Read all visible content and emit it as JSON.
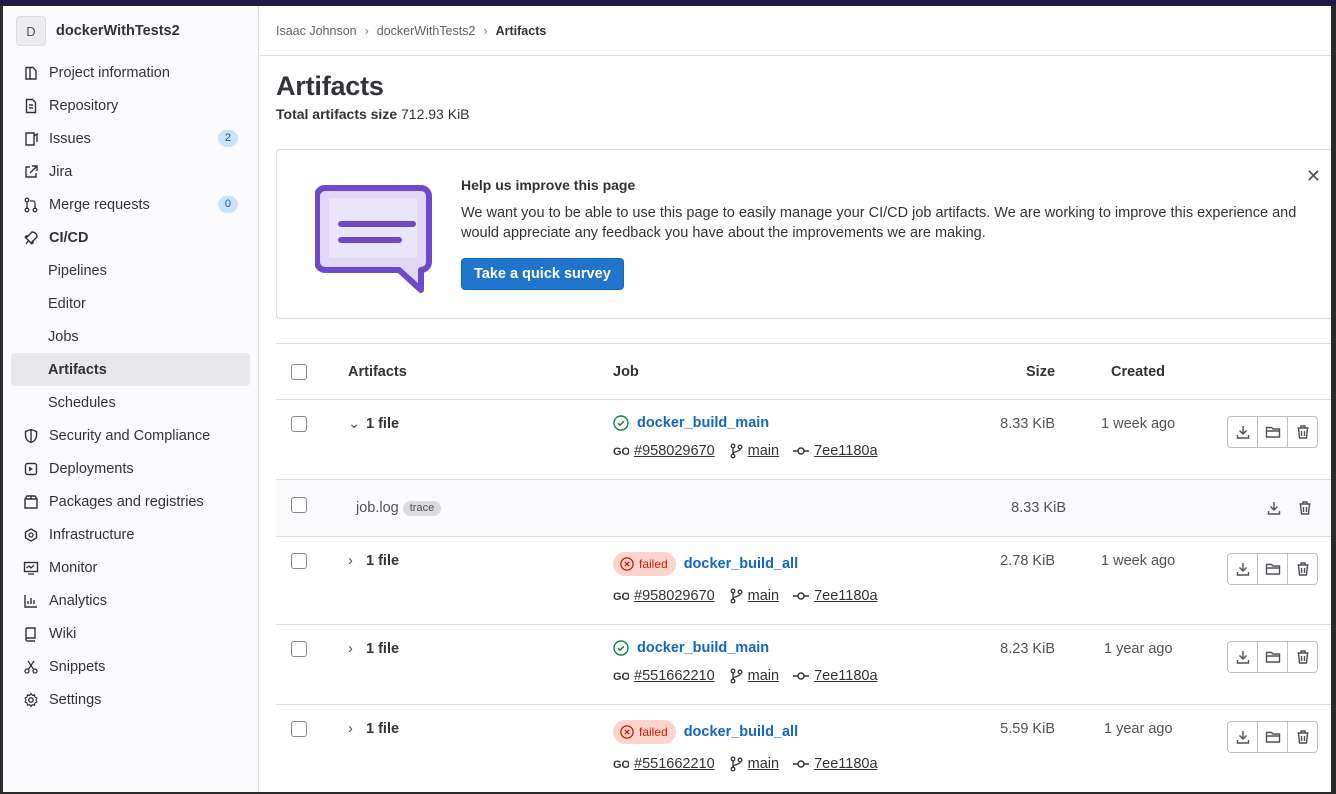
{
  "project": {
    "avatar_letter": "D",
    "name": "dockerWithTests2"
  },
  "sidebar": {
    "items": [
      {
        "label": "Project information",
        "icon": "project-icon"
      },
      {
        "label": "Repository",
        "icon": "doc-icon"
      },
      {
        "label": "Issues",
        "icon": "issues-icon",
        "badge": "2"
      },
      {
        "label": "Jira",
        "icon": "external-link-icon"
      },
      {
        "label": "Merge requests",
        "icon": "merge-request-icon",
        "badge": "0"
      },
      {
        "label": "CI/CD",
        "icon": "rocket-icon"
      },
      {
        "label": "Pipelines"
      },
      {
        "label": "Editor"
      },
      {
        "label": "Jobs"
      },
      {
        "label": "Artifacts"
      },
      {
        "label": "Schedules"
      },
      {
        "label": "Security and Compliance",
        "icon": "shield-icon"
      },
      {
        "label": "Deployments",
        "icon": "deployments-icon"
      },
      {
        "label": "Packages and registries",
        "icon": "package-icon"
      },
      {
        "label": "Infrastructure",
        "icon": "cloud-icon"
      },
      {
        "label": "Monitor",
        "icon": "monitor-icon"
      },
      {
        "label": "Analytics",
        "icon": "chart-icon"
      },
      {
        "label": "Wiki",
        "icon": "book-icon"
      },
      {
        "label": "Snippets",
        "icon": "scissors-icon"
      },
      {
        "label": "Settings",
        "icon": "gear-icon"
      }
    ]
  },
  "breadcrumb": {
    "items": [
      "Isaac Johnson",
      "dockerWithTests2",
      "Artifacts"
    ]
  },
  "page": {
    "title": "Artifacts",
    "total_label": "Total artifacts size",
    "total_value": "712.93 KiB"
  },
  "banner": {
    "title": "Help us improve this page",
    "text": "We want you to be able to use this page to easily manage your CI/CD job artifacts. We are working to improve this experience and would appreciate any feedback you have about the improvements we are making.",
    "button": "Take a quick survey",
    "close": "✕"
  },
  "table": {
    "headers": {
      "artifacts": "Artifacts",
      "job": "Job",
      "size": "Size",
      "created": "Created"
    },
    "rows": [
      {
        "files": "1 file",
        "status": "passed",
        "job": "docker_build_main",
        "pipeline": "#958029670",
        "branch": "main",
        "commit": "7ee1180a",
        "size": "8.33 KiB",
        "created": "1 week ago",
        "expanded": true
      },
      {
        "files": "1 file",
        "status": "failed",
        "status_label": "failed",
        "job": "docker_build_all",
        "pipeline": "#958029670",
        "branch": "main",
        "commit": "7ee1180a",
        "size": "2.78 KiB",
        "created": "1 week ago"
      },
      {
        "files": "1 file",
        "status": "passed",
        "job": "docker_build_main",
        "pipeline": "#551662210",
        "branch": "main",
        "commit": "7ee1180a",
        "size": "8.23 KiB",
        "created": "1 year ago"
      },
      {
        "files": "1 file",
        "status": "failed",
        "status_label": "failed",
        "job": "docker_build_all",
        "pipeline": "#551662210",
        "branch": "main",
        "commit": "7ee1180a",
        "size": "5.59 KiB",
        "created": "1 year ago"
      }
    ],
    "subrow": {
      "name": "job.log",
      "tag": "trace",
      "size": "8.33 KiB"
    }
  },
  "colors": {
    "accent": "#1f75cb",
    "success": "#108548",
    "danger": "#c91c00",
    "illustration": "#6e49cb"
  }
}
